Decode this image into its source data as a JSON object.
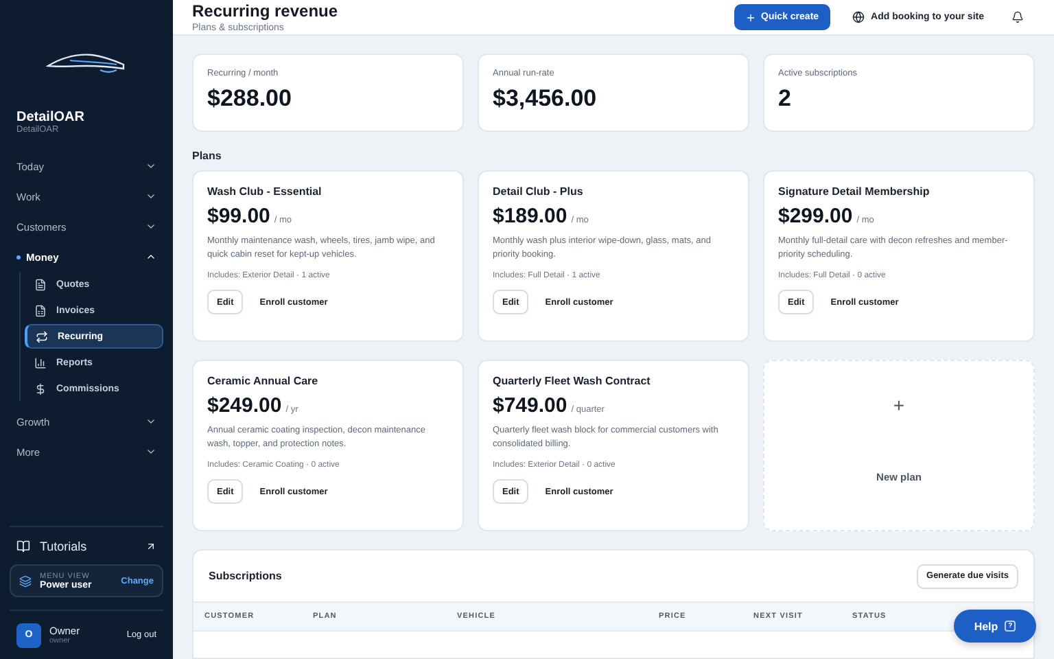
{
  "brand": {
    "name": "DetailOAR",
    "sub": "DetailOAR"
  },
  "nav": [
    {
      "label": "Today",
      "expanded": false,
      "selected": false
    },
    {
      "label": "Work",
      "expanded": false,
      "selected": false
    },
    {
      "label": "Customers",
      "expanded": false,
      "selected": false
    },
    {
      "label": "Money",
      "expanded": true,
      "selected": true,
      "children": [
        {
          "label": "Quotes",
          "selected": false
        },
        {
          "label": "Invoices",
          "selected": false
        },
        {
          "label": "Recurring",
          "selected": true
        },
        {
          "label": "Reports",
          "selected": false
        },
        {
          "label": "Commissions",
          "selected": false
        }
      ]
    },
    {
      "label": "Growth",
      "expanded": false,
      "selected": false
    },
    {
      "label": "More",
      "expanded": false,
      "selected": false
    }
  ],
  "tutorials": "Tutorials",
  "menu_view": {
    "label": "MENU VIEW",
    "value": "Power user",
    "action": "Change"
  },
  "user": {
    "initial": "O",
    "name": "Owner",
    "role": "owner",
    "logout": "Log out"
  },
  "header": {
    "title": "Recurring revenue",
    "subtitle": "Plans & subscriptions",
    "quick_create": "Quick create",
    "booking": "Add booking to your site"
  },
  "stats": [
    {
      "label": "Recurring / month",
      "value": "$288.00"
    },
    {
      "label": "Annual run-rate",
      "value": "$3,456.00"
    },
    {
      "label": "Active subscriptions",
      "value": "2"
    }
  ],
  "plans_heading": "Plans",
  "plans": [
    {
      "name": "Wash Club - Essential",
      "price": "$99.00",
      "period": "/ mo",
      "description": "Monthly maintenance wash, wheels, tires, jamb wipe, and quick cabin reset for kept-up vehicles.",
      "includes": "Includes: Exterior Detail · 1 active",
      "edit": "Edit",
      "enroll": "Enroll customer"
    },
    {
      "name": "Detail Club - Plus",
      "price": "$189.00",
      "period": "/ mo",
      "description": "Monthly wash plus interior wipe-down, glass, mats, and priority booking.",
      "includes": "Includes: Full Detail · 1 active",
      "edit": "Edit",
      "enroll": "Enroll customer"
    },
    {
      "name": "Signature Detail Membership",
      "price": "$299.00",
      "period": "/ mo",
      "description": "Monthly full-detail care with decon refreshes and member-priority scheduling.",
      "includes": "Includes: Full Detail · 0 active",
      "edit": "Edit",
      "enroll": "Enroll customer"
    },
    {
      "name": "Ceramic Annual Care",
      "price": "$249.00",
      "period": "/ yr",
      "description": "Annual ceramic coating inspection, decon maintenance wash, topper, and protection notes.",
      "includes": "Includes: Ceramic Coating · 0 active",
      "edit": "Edit",
      "enroll": "Enroll customer"
    },
    {
      "name": "Quarterly Fleet Wash Contract",
      "price": "$749.00",
      "period": "/ quarter",
      "description": "Quarterly fleet wash block for commercial customers with consolidated billing.",
      "includes": "Includes: Exterior Detail · 0 active",
      "edit": "Edit",
      "enroll": "Enroll customer"
    }
  ],
  "new_plan": {
    "icon": "+",
    "label": "New plan"
  },
  "subscriptions": {
    "title": "Subscriptions",
    "action": "Generate due visits",
    "columns": [
      "CUSTOMER",
      "PLAN",
      "VEHICLE",
      "PRICE",
      "NEXT VISIT",
      "STATUS"
    ]
  },
  "help": {
    "label": "Help",
    "icon": "?"
  }
}
